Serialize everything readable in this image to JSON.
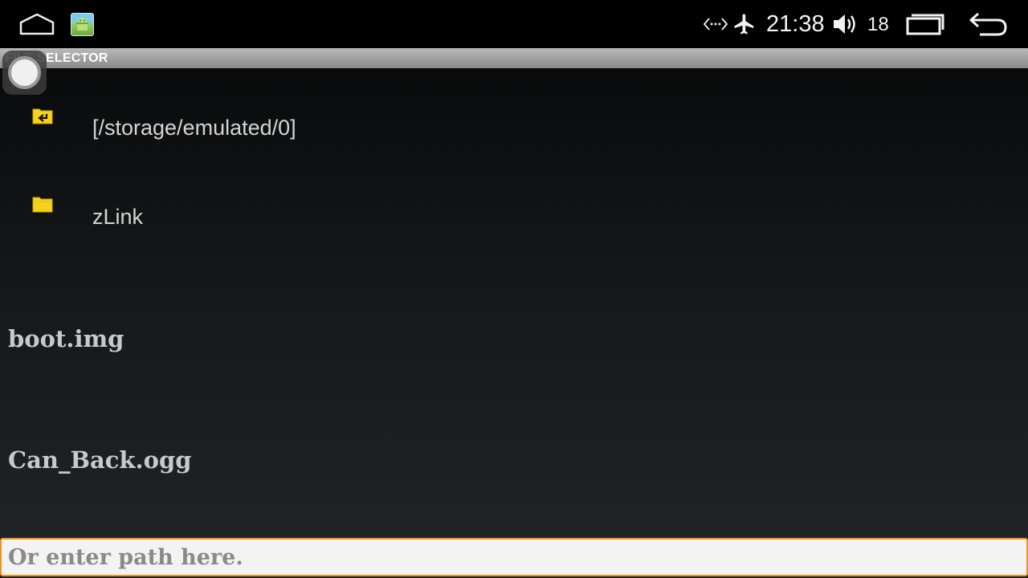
{
  "statusbar": {
    "icons": [
      "home-icon",
      "app-gallery-icon",
      "data-transfer-icon",
      "airplane-icon",
      "volume-icon",
      "recent-apps-icon",
      "back-arrow-icon"
    ],
    "time": "21:38",
    "volume_level": "18"
  },
  "window": {
    "title": "FILE SELECTOR"
  },
  "list": {
    "directories": [
      {
        "label": "[/storage/emulated/0]",
        "icon": "folder-up-icon"
      },
      {
        "label": "zLink",
        "icon": "folder-icon"
      }
    ],
    "files": [
      {
        "label": "boot.img"
      },
      {
        "label": "Can_Back.ogg"
      }
    ]
  },
  "path_input": {
    "value": "",
    "placeholder": "Or enter path here."
  },
  "colors": {
    "input_border": "#f0931e",
    "folder": "#f6d21d"
  }
}
